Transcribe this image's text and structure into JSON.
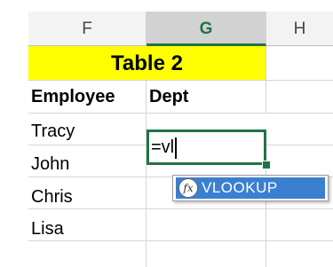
{
  "columns": [
    "F",
    "G",
    "H"
  ],
  "selected_column": "G",
  "table_title": "Table 2",
  "headers": {
    "employee": "Employee",
    "dept": "Dept"
  },
  "employees": [
    "Tracy",
    "John",
    "Chris",
    "Lisa"
  ],
  "active_cell": {
    "input": "=vl"
  },
  "autocomplete": {
    "icon_name": "function-icon",
    "icon_glyph": "fx",
    "item": "VLOOKUP"
  },
  "colors": {
    "title_fill": "#ffff00",
    "active_border": "#217346",
    "autocomplete_highlight": "#3b7fd1",
    "header_bg": "#f3f3f3"
  }
}
